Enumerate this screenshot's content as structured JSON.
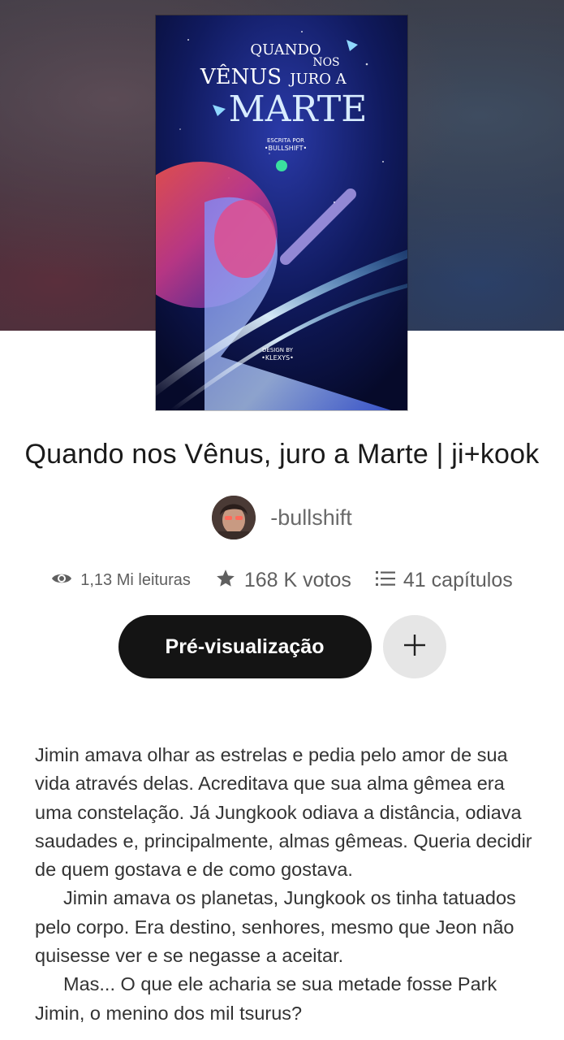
{
  "colors": {
    "primary_button_bg": "#141414",
    "secondary_button_bg": "#e6e6e6",
    "text_dark": "#1a1a1a",
    "text_muted": "#5f5f5f"
  },
  "cover": {
    "image": "book-cover-artwork",
    "title_line1": "QUANDO",
    "title_line2": "NOS",
    "title_line3": "VÊNUS",
    "title_line4": "JURO A",
    "title_line5": "MARTE",
    "written_by": "ESCRITA POR",
    "written_by_name": "•BULLSHIFT•",
    "design_by": "DESIGN BY",
    "design_by_name": "•KLEXYS•"
  },
  "story": {
    "title": "Quando nos Vênus, juro a Marte | ji+kook",
    "author": "-bullshift",
    "author_avatar": "author-avatar-photo"
  },
  "stats": {
    "reads_icon": "eye-icon",
    "reads": "1,13 Mi leituras",
    "votes_icon": "star-icon",
    "votes": "168 K votos",
    "chapters_icon": "list-icon",
    "chapters": "41 capítulos"
  },
  "actions": {
    "preview_label": "Pré-visualização",
    "add_icon": "plus-icon"
  },
  "description": {
    "paragraph1": "Jimin amava olhar as estrelas e pedia pelo amor de sua vida através delas. Acreditava que sua alma gêmea era uma constelação. Já Jungkook odiava a distância, odiava saudades e, principalmente, almas gêmeas. Queria decidir de quem gostava e de como gostava.",
    "paragraph2": "Jimin amava os planetas, Jungkook os tinha tatuados pelo corpo. Era destino, senhores, mesmo que Jeon não quisesse ver e se negasse a aceitar.",
    "paragraph3": "Mas... O que ele acharia se sua metade fosse Park Jimin, o menino dos mil tsurus?"
  }
}
